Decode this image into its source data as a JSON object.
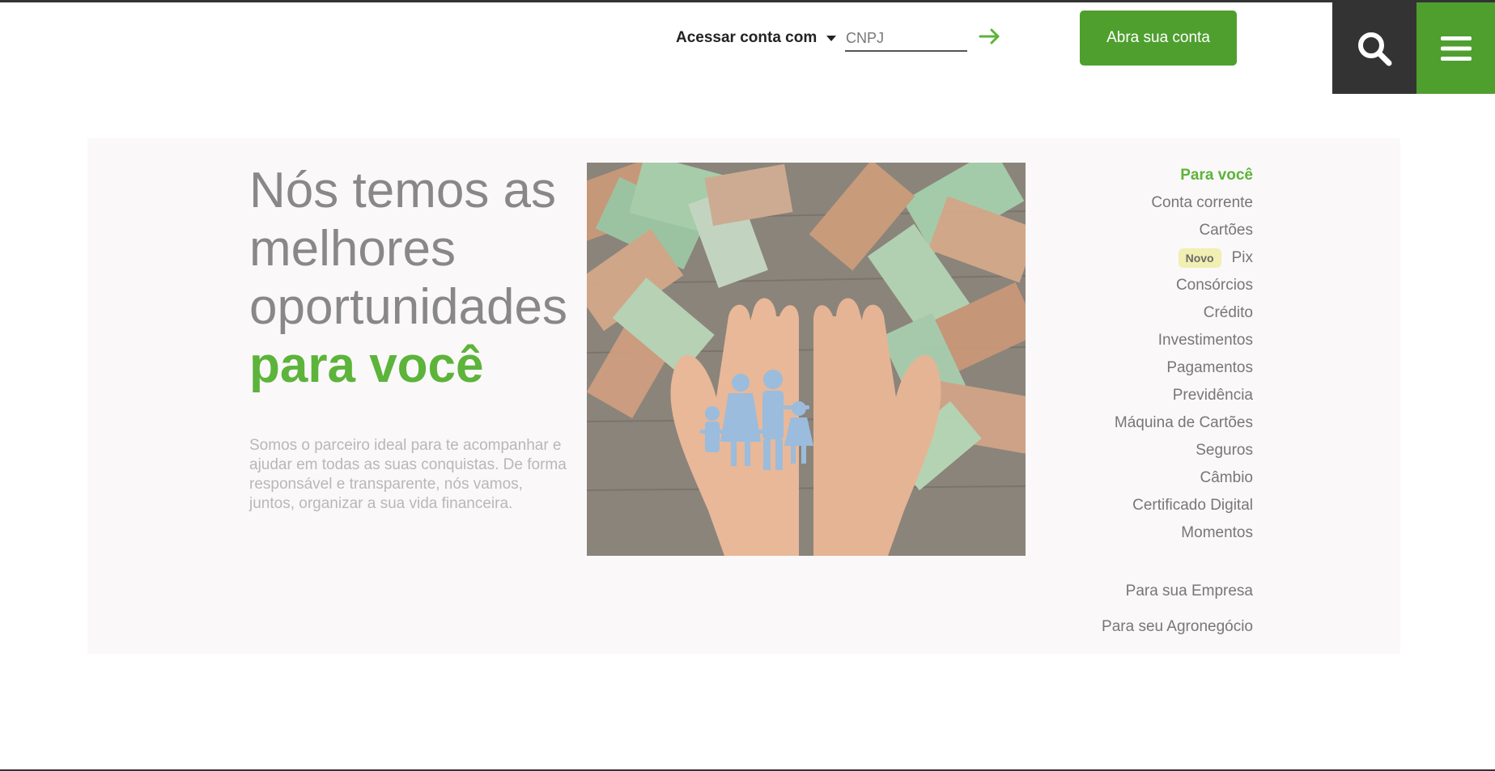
{
  "header": {
    "access_label": "Acessar conta com",
    "cnpj_placeholder": "CNPJ",
    "open_account_label": "Abra sua conta"
  },
  "hero": {
    "headline_line1": "Nós temos as",
    "headline_line2": "melhores",
    "headline_line3": "oportunidades",
    "headline_accent": "para você",
    "description": "Somos o parceiro ideal para te acompanhar e ajudar em todas as suas conquistas. De forma responsável e transparente, nós vamos, juntos, organizar a sua vida financeira."
  },
  "nav": {
    "items": [
      {
        "label": "Para você",
        "active": true
      },
      {
        "label": "Conta corrente"
      },
      {
        "label": "Cartões"
      },
      {
        "label": "Pix",
        "badge": "Novo"
      },
      {
        "label": "Consórcios"
      },
      {
        "label": "Crédito"
      },
      {
        "label": "Investimentos"
      },
      {
        "label": "Pagamentos"
      },
      {
        "label": "Previdência"
      },
      {
        "label": "Máquina de Cartões"
      },
      {
        "label": "Seguros"
      },
      {
        "label": "Câmbio"
      },
      {
        "label": "Certificado Digital"
      },
      {
        "label": "Momentos"
      }
    ],
    "empresa": "Para sua Empresa",
    "agro": "Para seu Agronegócio"
  },
  "colors": {
    "brand_green": "#4f9f2f",
    "accent_green": "#5cb43a",
    "dark": "#333333",
    "badge_bg": "#f1efb2"
  },
  "icons": {
    "search": "search-icon",
    "menu": "hamburger-menu-icon",
    "arrow": "arrow-right-icon",
    "caret": "caret-down-icon"
  }
}
